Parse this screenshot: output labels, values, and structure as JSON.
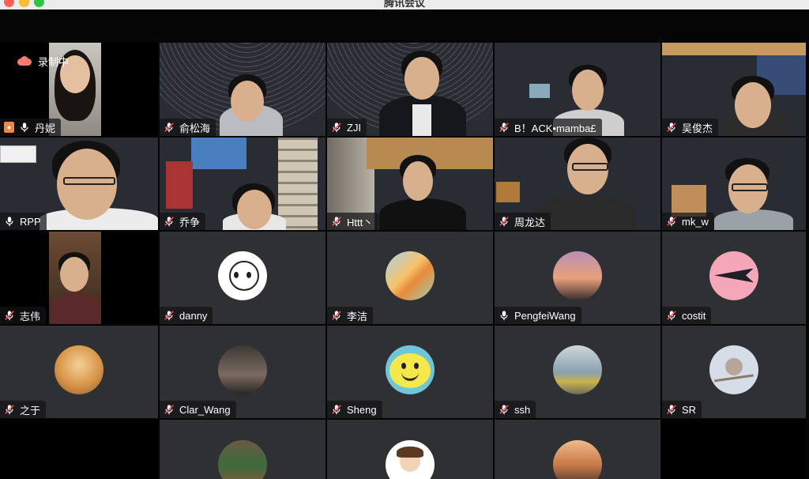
{
  "window": {
    "title": "腾讯会议"
  },
  "recording": {
    "label": "录制中"
  },
  "participants": [
    {
      "name": "丹妮",
      "mic": "on",
      "video": true
    },
    {
      "name": "俞松海",
      "mic": "muted",
      "video": true
    },
    {
      "name": "ZJI",
      "mic": "muted",
      "video": true
    },
    {
      "name": "B！ACK•mamba£",
      "mic": "muted",
      "video": true
    },
    {
      "name": "吴俊杰",
      "mic": "muted",
      "video": true
    },
    {
      "name": "RPP",
      "mic": "on",
      "video": true
    },
    {
      "name": "乔争",
      "mic": "muted",
      "video": true
    },
    {
      "name": "Httt丶",
      "mic": "muted",
      "video": true
    },
    {
      "name": "周龙达",
      "mic": "muted",
      "video": true
    },
    {
      "name": "mk_w",
      "mic": "muted",
      "video": true
    },
    {
      "name": "志伟",
      "mic": "muted",
      "video": true
    },
    {
      "name": "danny",
      "mic": "muted",
      "video": false
    },
    {
      "name": "李洁",
      "mic": "muted",
      "video": false
    },
    {
      "name": "PengfeiWang",
      "mic": "on",
      "video": false
    },
    {
      "name": "costit",
      "mic": "muted",
      "video": false
    },
    {
      "name": "之于",
      "mic": "muted",
      "video": false
    },
    {
      "name": "Clar_Wang",
      "mic": "muted",
      "video": false
    },
    {
      "name": "Sheng",
      "mic": "muted",
      "video": false
    },
    {
      "name": "ssh",
      "mic": "muted",
      "video": false
    },
    {
      "name": "SR",
      "mic": "muted",
      "video": false
    }
  ]
}
